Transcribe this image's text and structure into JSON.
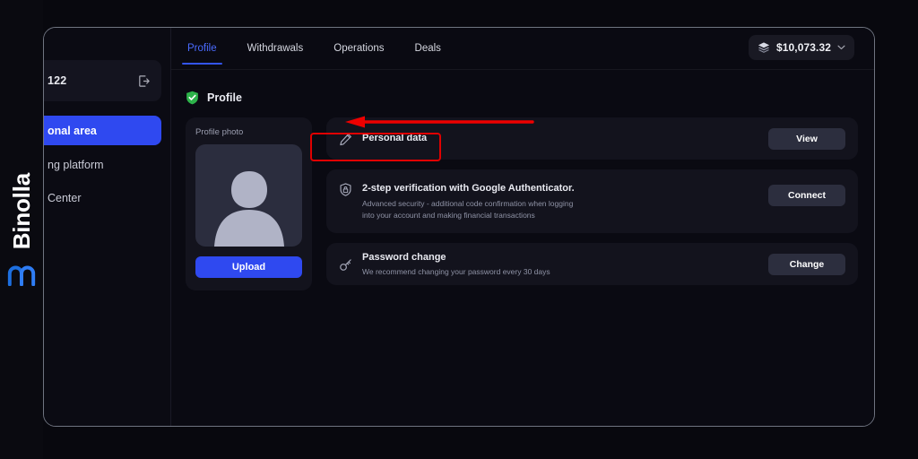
{
  "brand": {
    "name": "Binolla",
    "logo_icon": "binolla-arch-logo"
  },
  "sidebar": {
    "account_id": "122",
    "logout_icon": "logout-icon",
    "items": [
      {
        "label": "onal area",
        "full": "Personal area",
        "active": true
      },
      {
        "label": "ng platform",
        "full": "Trading platform",
        "active": false
      },
      {
        "label": "Center",
        "full": "Help Center",
        "active": false
      }
    ]
  },
  "topbar": {
    "tabs": [
      {
        "label": "Profile",
        "active": true
      },
      {
        "label": "Withdrawals",
        "active": false
      },
      {
        "label": "Operations",
        "active": false
      },
      {
        "label": "Deals",
        "active": false
      }
    ],
    "balance": {
      "amount": "$10,073.32",
      "coin_icon": "stacked-coins-icon",
      "chevron_icon": "chevron-down-icon"
    }
  },
  "section": {
    "title": "Profile",
    "status_icon": "green-shield-check-icon"
  },
  "photo_card": {
    "label": "Profile photo",
    "avatar_icon": "user-avatar-placeholder",
    "upload_label": "Upload"
  },
  "rows": [
    {
      "icon": "pencil-edit-icon",
      "title": "Personal data",
      "subtitle": "",
      "button": "View"
    },
    {
      "icon": "shield-lock-icon",
      "title": "2-step verification with Google Authenticator.",
      "subtitle": "Advanced security - additional code confirmation when logging into your account and making financial transactions",
      "button": "Connect"
    },
    {
      "icon": "key-icon",
      "title": "Password change",
      "subtitle": "We recommend changing your password every 30 days",
      "button": "Change"
    }
  ],
  "annotation": {
    "box_color": "#e00000",
    "arrow_color": "#ee0000",
    "arrow_icon": "red-left-arrow-annotation",
    "box_icon": "red-highlight-box-annotation"
  },
  "colors": {
    "accent_blue": "#2f49f0",
    "tab_active": "#4a6bff",
    "card_bg": "#13131d",
    "page_bg": "#0a0a12",
    "shield_green": "#2db34a"
  }
}
